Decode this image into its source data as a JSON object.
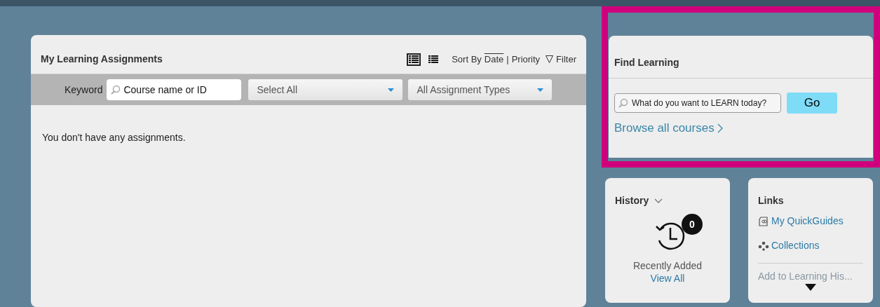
{
  "assignments": {
    "title": "My Learning Assignments",
    "views": [
      {
        "selected": true
      },
      {
        "selected": false
      }
    ],
    "sort": {
      "label": "Sort By",
      "options": [
        {
          "label": "Date",
          "selected": true
        },
        {
          "label": "Priority",
          "selected": false
        }
      ],
      "separator": "|"
    },
    "filter": {
      "label": "Filter"
    },
    "keyword": {
      "label": "Keyword",
      "placeholder": "Course name or ID"
    },
    "dropdowns": [
      {
        "value": "Select All"
      },
      {
        "value": "All Assignment Types"
      }
    ],
    "empty_message": "You don't have any assignments."
  },
  "find_learning": {
    "title": "Find Learning",
    "highlighted": true,
    "search": {
      "placeholder": "What do you want to LEARN today?"
    },
    "go_button": "Go",
    "browse_link": "Browse all courses"
  },
  "history": {
    "title": "History",
    "count": "0",
    "caption": "Recently Added",
    "link": "View All"
  },
  "links": {
    "title": "Links",
    "items": [
      {
        "kind": "guide",
        "label": "My QuickGuides",
        "faded": false
      },
      {
        "kind": "collection",
        "label": "Collections",
        "faded": false
      },
      {
        "kind": "plain",
        "label": "Add to Learning His...",
        "faded": true
      }
    ]
  }
}
